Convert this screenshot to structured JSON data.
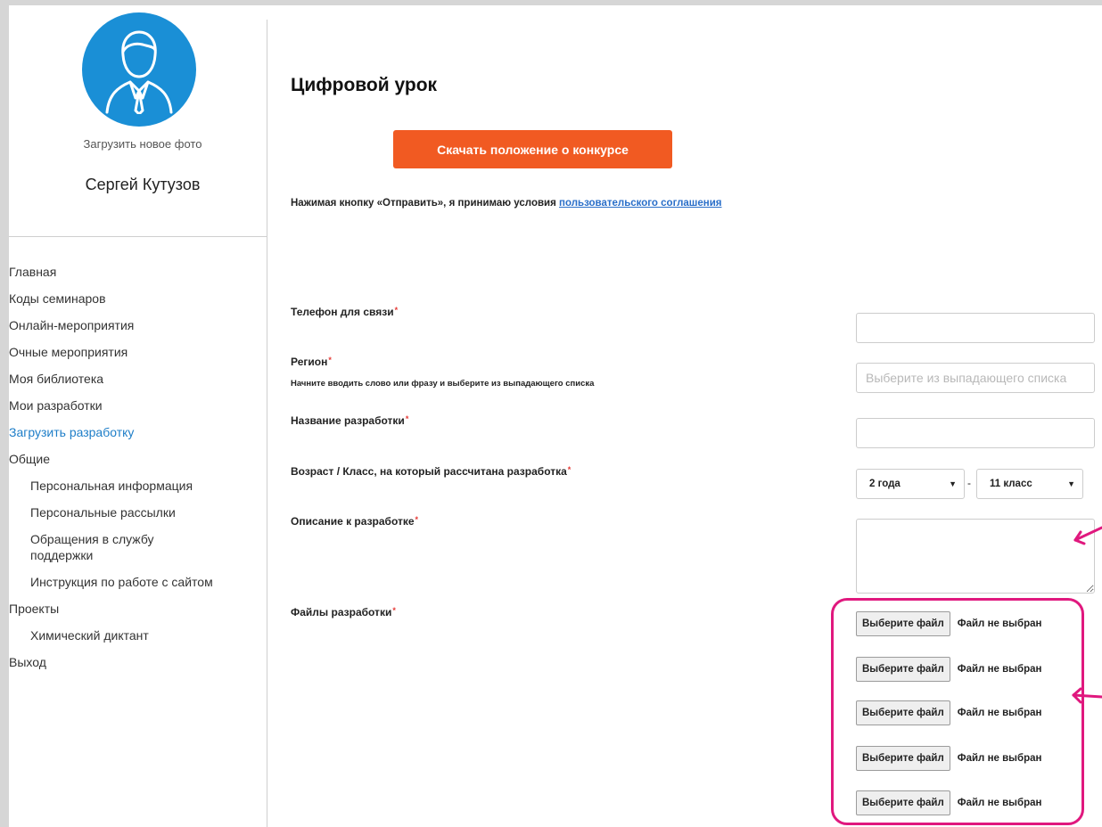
{
  "sidebar": {
    "upload_photo": "Загрузить новое фото",
    "user_name": "Сергей Кутузов",
    "items": [
      {
        "label": "Главная"
      },
      {
        "label": "Коды семинаров"
      },
      {
        "label": "Онлайн-мероприятия"
      },
      {
        "label": "Очные мероприятия"
      },
      {
        "label": "Моя библиотека"
      },
      {
        "label": "Мои разработки"
      },
      {
        "label": "Загрузить разработку",
        "active": true
      },
      {
        "label": "Общие"
      },
      {
        "label": "Персональная информация",
        "sub": true
      },
      {
        "label": "Персональные рассылки",
        "sub": true
      },
      {
        "label": "Обращения в службу поддержки",
        "sub": true
      },
      {
        "label": "Инструкция по работе с сайтом",
        "sub": true
      },
      {
        "label": "Проекты"
      },
      {
        "label": "Химический диктант",
        "sub": true
      },
      {
        "label": "Выход"
      }
    ]
  },
  "main": {
    "title": "Цифровой урок",
    "download_button": "Скачать положение о конкурсе",
    "agreement_text": "Нажимая кнопку «Отправить», я принимаю условия",
    "agreement_link": "пользовательского соглашения"
  },
  "form": {
    "required_mark": "*",
    "phone_label": "Телефон для связи",
    "region_label": "Регион",
    "region_hint": "Начните вводить слово или фразу и выберите из выпадающего списка",
    "region_placeholder": "Выберите из выпадающего списка",
    "name_label": "Название разработки",
    "age_label": "Возраст / Класс, на который рассчитана разработка",
    "age_from": "2 года",
    "age_separator": "-",
    "age_to": "11 класс",
    "description_label": "Описание к разработке",
    "files_label": "Файлы разработки",
    "file_inputs": [
      {
        "button": "Выберите файл",
        "status": "Файл не выбран"
      },
      {
        "button": "Выберите файл",
        "status": "Файл не выбран"
      },
      {
        "button": "Выберите файл",
        "status": "Файл не выбран"
      },
      {
        "button": "Выберите файл",
        "status": "Файл не выбран"
      },
      {
        "button": "Выберите файл",
        "status": "Файл не выбран"
      }
    ]
  },
  "colors": {
    "accent_orange": "#f15a22",
    "avatar_blue": "#1a8fd6",
    "active_link": "#1e7ec8",
    "annotation_pink": "#e0187e",
    "required_red": "#e53935"
  },
  "icons": {
    "avatar": "user-avatar-icon",
    "dropdown": "triangle-down-icon",
    "annotation": "arrow-icon"
  }
}
